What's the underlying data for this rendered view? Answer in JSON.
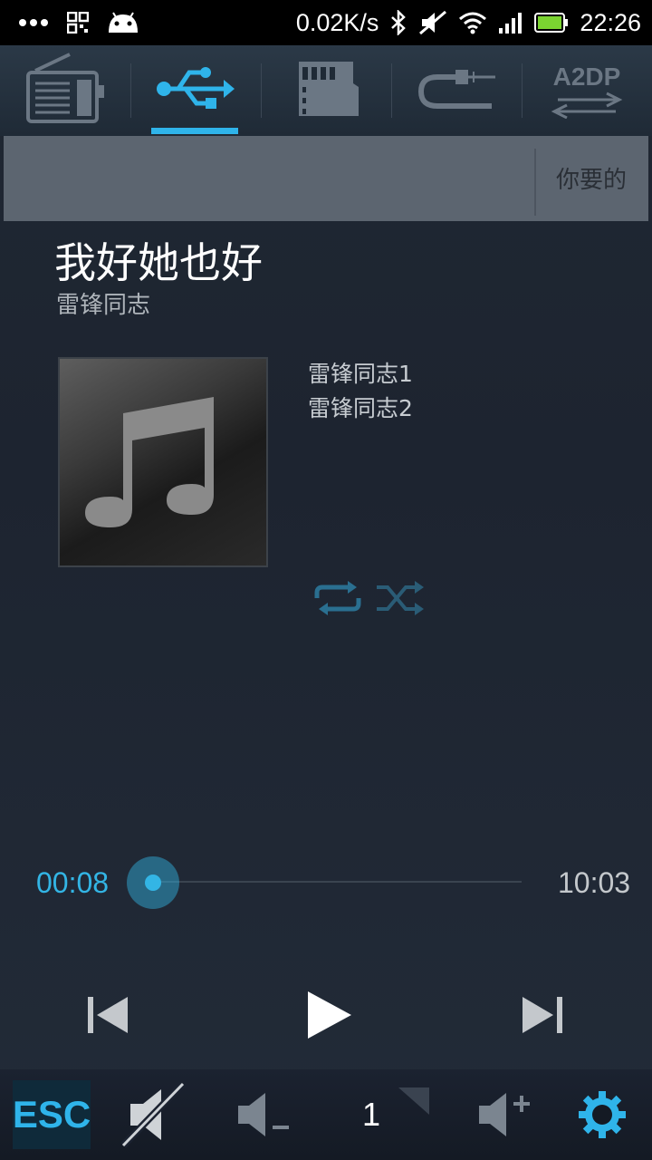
{
  "status_bar": {
    "net_speed": "0.02K/s",
    "time": "22:26",
    "battery_level": 1.0,
    "icons": [
      "more-dots-icon",
      "qr-icon",
      "android-icon",
      "bluetooth-icon",
      "mute-icon",
      "wifi-icon",
      "signal-icon",
      "battery-icon"
    ]
  },
  "tabs": {
    "items": [
      "radio-icon",
      "usb-icon",
      "sd-card-icon",
      "aux-cable-icon",
      "a2dp-icon"
    ],
    "a2dp_label": "A2DP",
    "selected_index": 1
  },
  "strip": {
    "text": "你要的"
  },
  "song": {
    "title": "我好她也好",
    "artist": "雷锋同志"
  },
  "playlist": [
    "雷锋同志1",
    "雷锋同志2"
  ],
  "progress": {
    "current": "00:08",
    "total": "10:03",
    "fraction": 0.013
  },
  "volume": {
    "level": "1"
  },
  "bottom_bar": {
    "esc_label": "ESC"
  },
  "colors": {
    "accent": "#33b5e5",
    "background": "#1d2430"
  }
}
